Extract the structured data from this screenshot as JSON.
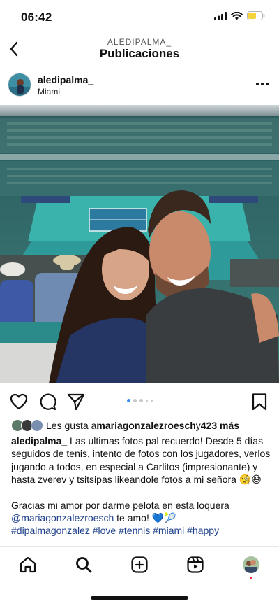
{
  "status_bar": {
    "time": "06:42"
  },
  "header": {
    "subtitle": "ALEDIPALMA_",
    "title": "Publicaciones"
  },
  "post": {
    "username": "aledipalma_",
    "location": "Miami",
    "image_description_icon": "photo",
    "carousel": {
      "total": 5,
      "active_index": 0
    }
  },
  "likes": {
    "prefix": "Les gusta a ",
    "user": "mariagonzalezroesch",
    "connector": " y ",
    "count": "423 más"
  },
  "caption": {
    "user": "aledipalma_",
    "text1": " Las ultimas fotos pal recuerdo! Desde 5 días seguidos de tenis, intento de fotos con los jugadores, verlos jugando a todos, en especial a Carlitos (impresionante) y hasta zverev y tsitsipas likeandole fotos a mi señora 🧐😅",
    "text2": "Gracias mi amor por darme pelota en esta loquera ",
    "mention": "@mariagonzalezroesch",
    "text3": " te amo! 💙🎾",
    "hashtags": "#dipalmagonzalez #love #tennis #miami #happy"
  },
  "colors": {
    "accent": "#3a8ff7",
    "link": "#1d3f8a",
    "battery": "#f5d33a",
    "notif": "#ff3040"
  },
  "icons": {
    "status": [
      "cellular-signal-icon",
      "wifi-icon",
      "battery-icon"
    ],
    "header": [
      "back-chevron-icon"
    ],
    "actions": [
      "heart-icon",
      "comment-icon",
      "share-icon",
      "bookmark-icon"
    ],
    "nav": [
      "home-icon",
      "search-icon",
      "create-icon",
      "reels-icon",
      "profile-avatar"
    ]
  }
}
